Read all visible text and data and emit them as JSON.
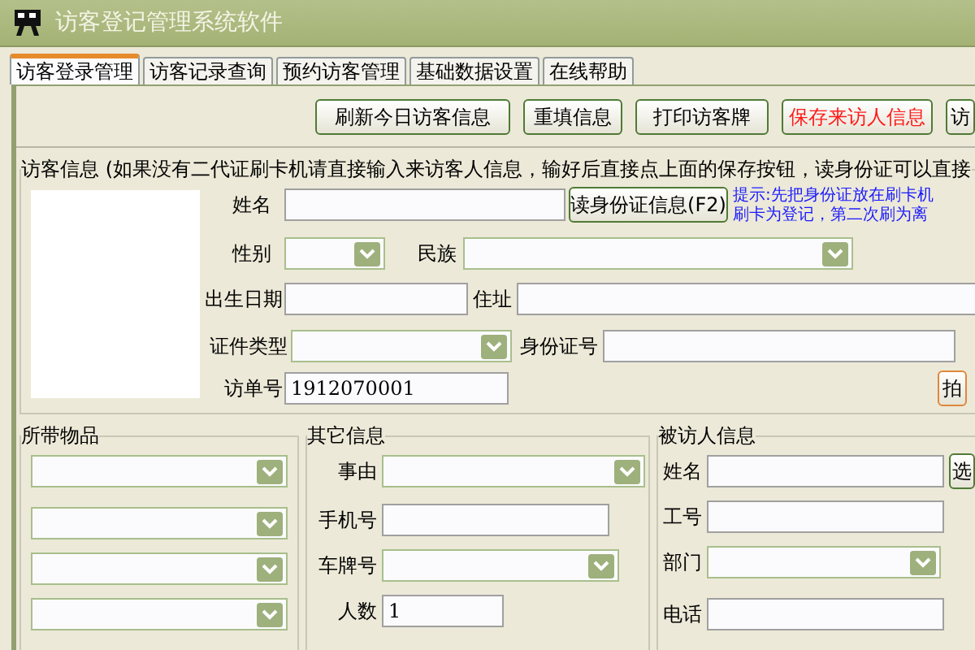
{
  "window": {
    "title": "访客登记管理系统软件"
  },
  "tabs": [
    {
      "label": "访客登录管理",
      "selected": true
    },
    {
      "label": "访客记录查询",
      "selected": false
    },
    {
      "label": "预约访客管理",
      "selected": false
    },
    {
      "label": "基础数据设置",
      "selected": false
    },
    {
      "label": "在线帮助",
      "selected": false
    }
  ],
  "toolbar": [
    {
      "label": "刷新今日访客信息",
      "kind": "normal"
    },
    {
      "label": "重填信息",
      "kind": "normal"
    },
    {
      "label": "打印访客牌",
      "kind": "normal"
    },
    {
      "label": "保存来访人信息",
      "kind": "highlight"
    },
    {
      "label": "访",
      "kind": "normal"
    }
  ],
  "visitor_info": {
    "legend": "访客信息 (如果没有二代证刷卡机请直接输入来访客人信息，输好后直接点上面的保存按钮，读身份证可以直接",
    "name": {
      "label": "姓名"
    },
    "read_id_button": "读身份证信息(F2)",
    "hint": [
      "提示:先把身份证放在刷卡机",
      "刷卡为登记，第二次刷为离"
    ],
    "gender": {
      "label": "性别"
    },
    "ethnicity": {
      "label": "民族"
    },
    "birth_date": {
      "label": "出生日期"
    },
    "address": {
      "label": "住址"
    },
    "id_type": {
      "label": "证件类型"
    },
    "id_number": {
      "label": "身份证号"
    },
    "visit_number": {
      "label": "访单号",
      "value": "1912070001"
    },
    "photo_button": "拍"
  },
  "carried_items": {
    "legend": "所带物品",
    "fields": [
      {
        "kind": "dropdown"
      },
      {
        "kind": "dropdown"
      },
      {
        "kind": "dropdown"
      },
      {
        "kind": "dropdown"
      }
    ]
  },
  "other_info": {
    "legend": "其它信息",
    "fields": [
      {
        "label": "事由",
        "kind": "dropdown"
      },
      {
        "label": "手机号",
        "kind": "text"
      },
      {
        "label": "车牌号",
        "kind": "dropdown"
      },
      {
        "label": "人数",
        "kind": "text",
        "value": "1"
      }
    ]
  },
  "visitee_info": {
    "legend": "被访人信息",
    "fields": [
      {
        "label": "姓名",
        "kind": "text",
        "button": "选"
      },
      {
        "label": "工号",
        "kind": "text"
      },
      {
        "label": "部门",
        "kind": "dropdown"
      },
      {
        "label": "电话",
        "kind": "text"
      }
    ]
  }
}
